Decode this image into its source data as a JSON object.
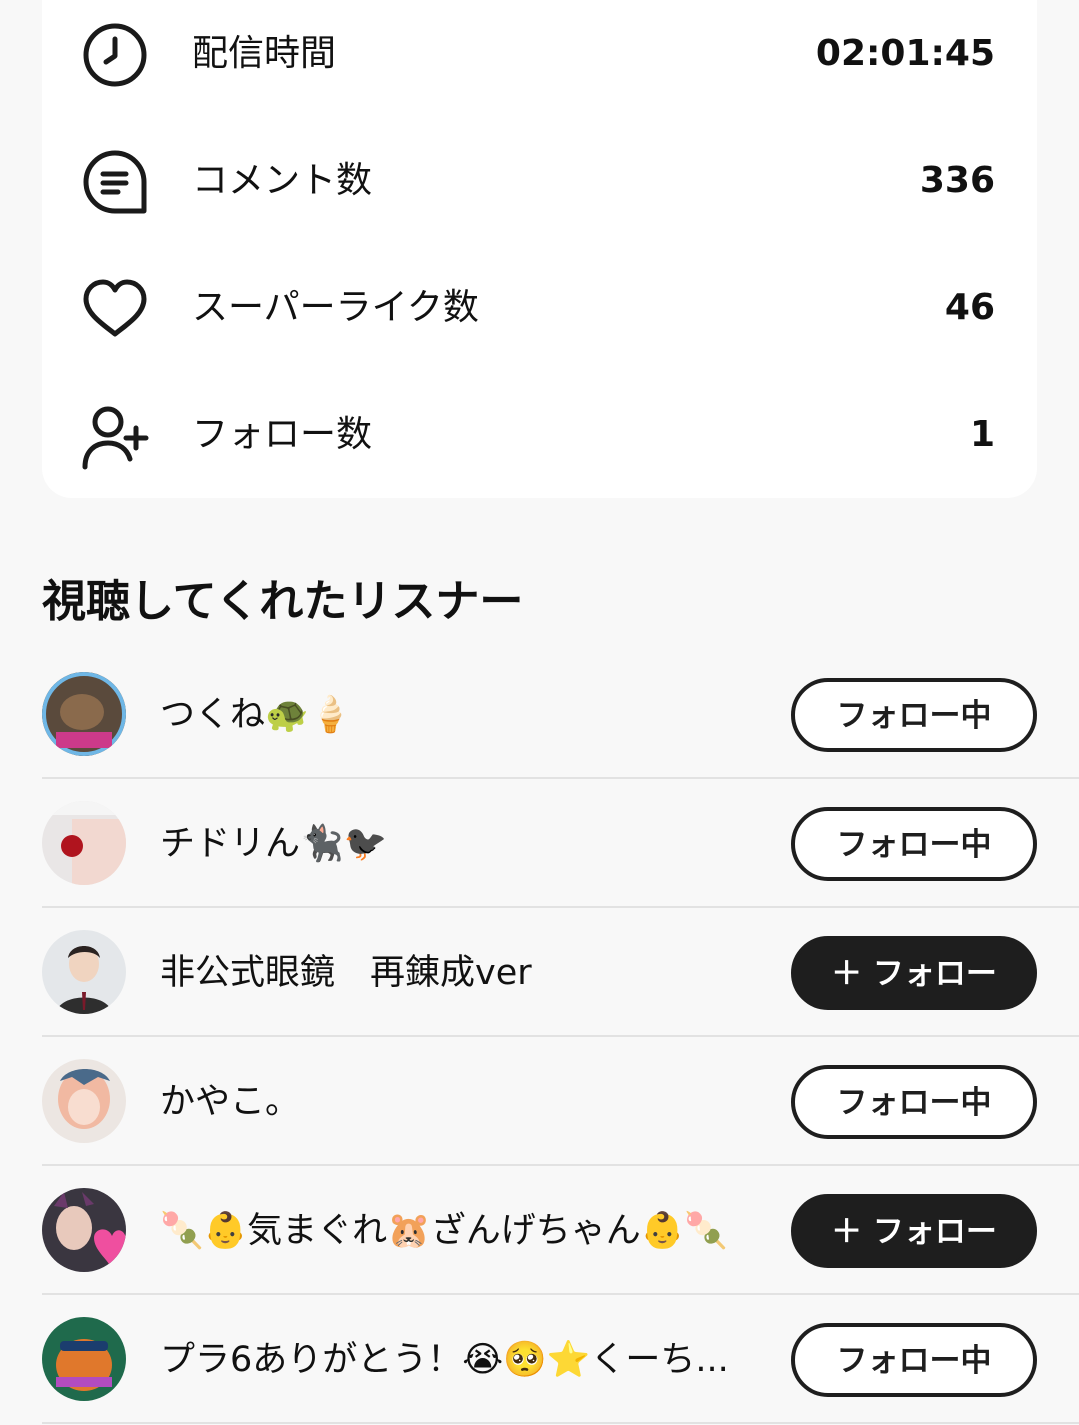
{
  "stats": [
    {
      "icon": "clock-icon",
      "label": "配信時間",
      "value": "02:01:45"
    },
    {
      "icon": "comment-icon",
      "label": "コメント数",
      "value": "336"
    },
    {
      "icon": "heart-icon",
      "label": "スーパーライク数",
      "value": "46"
    },
    {
      "icon": "add-user-icon",
      "label": "フォロー数",
      "value": "1"
    }
  ],
  "section_title": "視聴してくれたリスナー",
  "listeners": [
    {
      "name": "つくね🐢🍦",
      "button": "フォロー中",
      "following": true
    },
    {
      "name": "チドリん🐈‍⬛🐦‍⬛",
      "button": "フォロー中",
      "following": true
    },
    {
      "name": "非公式眼鏡　再錬成ver",
      "button": "＋ フォロー",
      "following": false
    },
    {
      "name": "かやこ。",
      "button": "フォロー中",
      "following": true
    },
    {
      "name": "🍡👶気まぐれ🐹ざんげちゃん👶🍡",
      "button": "＋ フォロー",
      "following": false
    },
    {
      "name": "プラ6ありがとう！😭🥺⭐くーち...",
      "button": "フォロー中",
      "following": true
    }
  ],
  "colors": {
    "accent_dark": "#1e1e1e",
    "background": "#f8f8f8",
    "card": "#ffffff"
  }
}
